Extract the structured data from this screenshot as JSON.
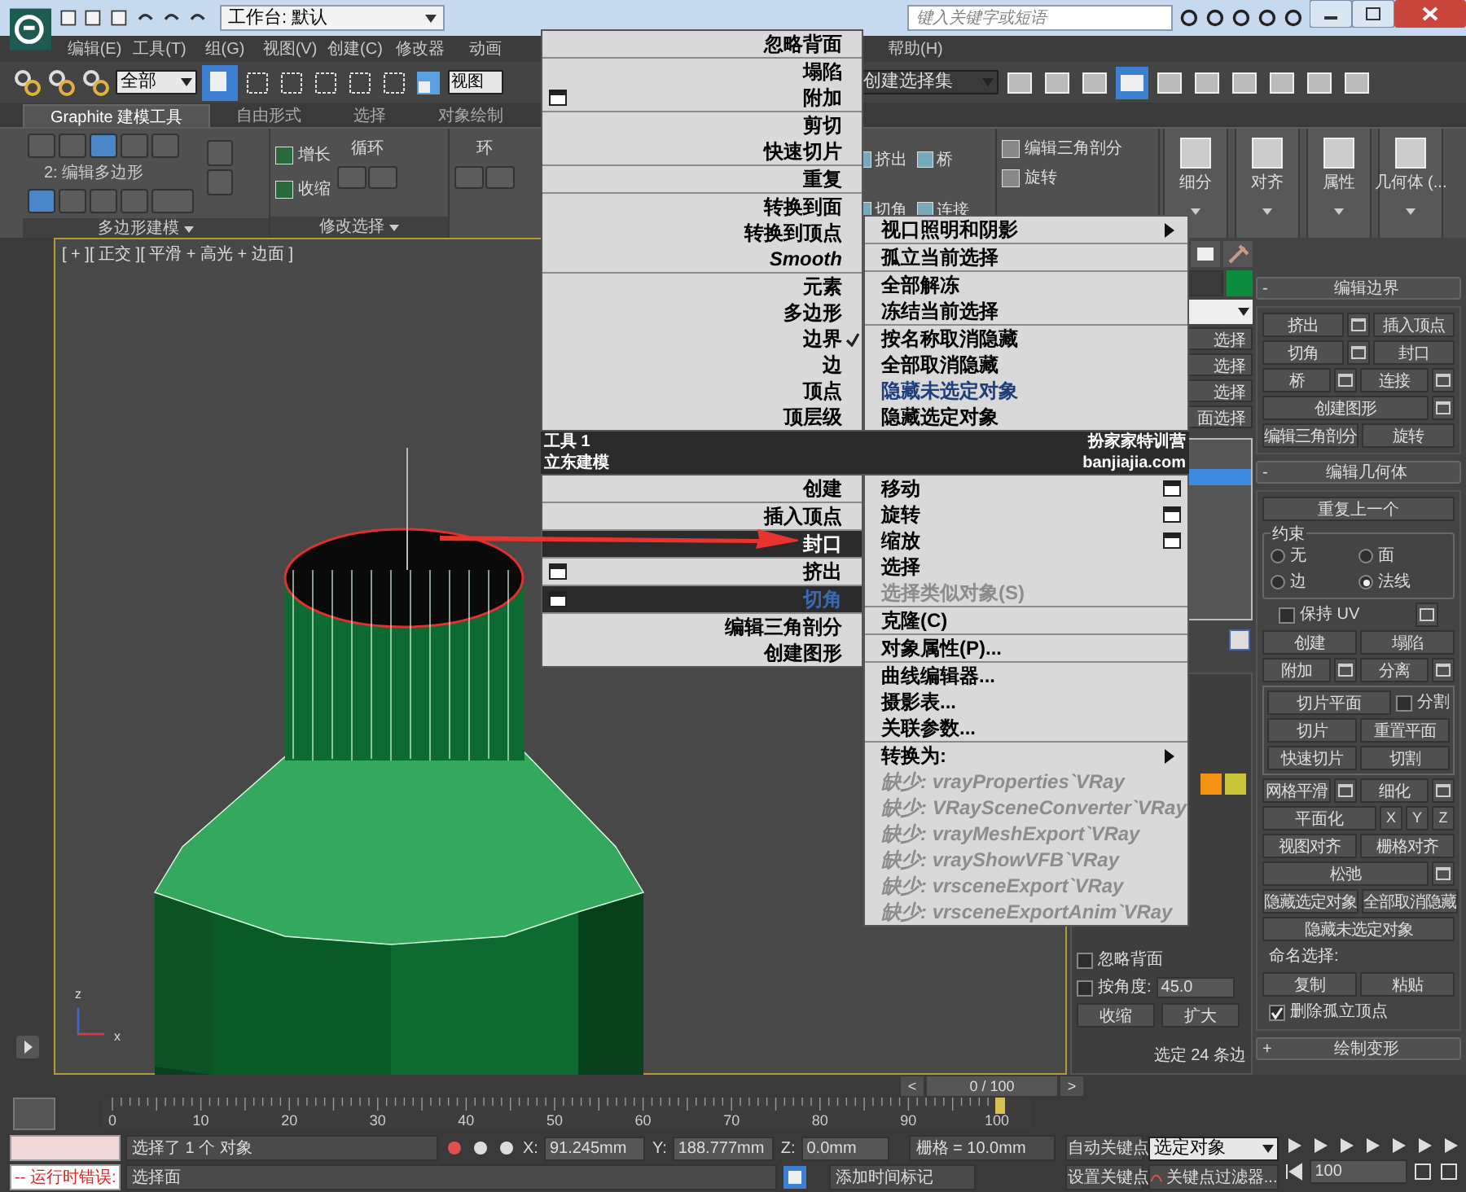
{
  "title_bar": {
    "workspace": "工作台: 默认",
    "search": {
      "placeholder": "键入关键字或短语"
    }
  },
  "menu_bar": [
    "编辑(E)",
    "工具(T)",
    "组(G)",
    "视图(V)",
    "创建(C)",
    "修改器",
    "动画",
    "帮助(H)"
  ],
  "toolbar": {
    "filter": "全部",
    "coord": "视图",
    "selection_set": "创建选择集"
  },
  "ribbon": {
    "tabs": [
      {
        "label": "Graphite 建模工具",
        "selected": true
      },
      {
        "label": "自由形式",
        "selected": false
      },
      {
        "label": "选择",
        "selected": false
      },
      {
        "label": "对象绘制",
        "selected": false
      }
    ],
    "level": "2: 编辑多边形",
    "grow": "增长",
    "shrink": "收缩",
    "loop": "循环",
    "ring": "环",
    "panels": [
      "多边形建模",
      "修改选择"
    ],
    "edit_tools": [
      "挤出",
      "桥",
      "切角",
      "连接"
    ],
    "tri": "编辑三角剖分",
    "turn": "旋转",
    "big_buttons": [
      "细分",
      "对齐",
      "属性",
      "几何体 (..."
    ]
  },
  "viewport": {
    "label": "[ + ][ 正交 ][ 平滑 + 高光 + 边面 ]",
    "axis_labels": [
      "z",
      "x"
    ]
  },
  "quad_menu": {
    "top_left": [
      [
        {
          "label": "忽略背面"
        }
      ],
      [
        {
          "label": "塌陷"
        },
        {
          "label": "附加",
          "options": true
        }
      ],
      [
        {
          "label": "剪切"
        },
        {
          "label": "快速切片"
        }
      ],
      [
        {
          "label": "重复"
        }
      ],
      [
        {
          "label": "转换到面"
        },
        {
          "label": "转换到顶点"
        },
        {
          "label": "Smooth",
          "italic": true
        }
      ],
      [
        {
          "label": "元素"
        },
        {
          "label": "多边形"
        },
        {
          "label": "边界",
          "checked": true
        },
        {
          "label": "边"
        },
        {
          "label": "顶点"
        },
        {
          "label": "顶层级"
        }
      ]
    ],
    "top_right": [
      [
        {
          "label": "视口照明和阴影",
          "submenu": true
        }
      ],
      [
        {
          "label": "孤立当前选择"
        }
      ],
      [
        {
          "label": "全部解冻"
        },
        {
          "label": "冻结当前选择"
        }
      ],
      [
        {
          "label": "按名称取消隐藏"
        },
        {
          "label": "全部取消隐藏"
        },
        {
          "label": "隐藏未选定对象",
          "accent": true
        },
        {
          "label": "隐藏选定对象"
        }
      ]
    ],
    "headers": [
      {
        "left": "工具 1",
        "right": "扮家家特训营"
      },
      {
        "left": "立东建模",
        "right": "banjiajia.com"
      }
    ],
    "bottom_left": [
      [
        {
          "label": "创建"
        }
      ],
      [
        {
          "label": "插入顶点"
        }
      ],
      [
        {
          "label": "封口",
          "selected": true
        }
      ],
      [
        {
          "label": "挤出",
          "options": true
        }
      ],
      [
        {
          "label": "切角",
          "options": true,
          "selected": true,
          "accent": true
        }
      ],
      [
        {
          "label": "编辑三角剖分"
        },
        {
          "label": "创建图形"
        }
      ]
    ],
    "bottom_right": [
      [
        {
          "label": "移动",
          "options": true
        },
        {
          "label": "旋转",
          "options": true
        },
        {
          "label": "缩放",
          "options": true
        },
        {
          "label": "选择"
        },
        {
          "label": "选择类似对象(S)",
          "disabled": true
        }
      ],
      [
        {
          "label": "克隆(C)"
        }
      ],
      [
        {
          "label": "对象属性(P)..."
        }
      ],
      [
        {
          "label": "曲线编辑器..."
        },
        {
          "label": "摄影表..."
        },
        {
          "label": "关联参数..."
        }
      ],
      [
        {
          "label": "转换为:",
          "submenu": true
        },
        {
          "label": "缺少: vrayProperties`VRay",
          "disabled": true,
          "italic": true
        },
        {
          "label": "缺少: VRaySceneConverter`VRay",
          "disabled": true,
          "italic": true
        },
        {
          "label": "缺少: vrayMeshExport`VRay",
          "disabled": true,
          "italic": true
        },
        {
          "label": "缺少: vrayShowVFB`VRay",
          "disabled": true,
          "italic": true
        },
        {
          "label": "缺少: vrsceneExport`VRay",
          "disabled": true,
          "italic": true
        },
        {
          "label": "缺少: vrsceneExportAnim`VRay",
          "disabled": true,
          "italic": true
        }
      ]
    ]
  },
  "command_panel": {
    "selection_buttons": [
      "选择",
      "选择",
      "选择",
      "面选择"
    ],
    "selection_rollout": {
      "ignore_backfacing": {
        "label": "忽略背面",
        "checked": false
      },
      "by_angle": {
        "label": "按角度:",
        "value": "45.0",
        "checked": false
      },
      "shrink": "收缩",
      "grow": "扩大",
      "status": "选定 24 条边"
    },
    "edit_borders": {
      "toggle": "-",
      "title": "编辑边界",
      "rows": [
        [
          {
            "label": "挤出",
            "options": true
          },
          {
            "label": "插入顶点"
          }
        ],
        [
          {
            "label": "切角",
            "options": true
          },
          {
            "label": "封口"
          }
        ],
        [
          {
            "label": "桥",
            "options": true
          },
          {
            "label": "连接",
            "options": true
          }
        ],
        [
          {
            "label": "创建图形",
            "options": true
          }
        ],
        [
          {
            "label": "编辑三角剖分"
          },
          {
            "label": "旋转"
          }
        ]
      ]
    },
    "edit_geometry": {
      "toggle": "-",
      "title": "编辑几何体",
      "repeat": "重复上一个",
      "constraints": {
        "title": "约束",
        "options": [
          {
            "label": "无",
            "selected": false
          },
          {
            "label": "边",
            "selected": false
          },
          {
            "label": "面",
            "selected": false
          },
          {
            "label": "法线",
            "selected": true
          }
        ]
      },
      "preserve_uv": {
        "label": "保持 UV",
        "checked": false
      },
      "rows1": [
        [
          {
            "label": "创建"
          },
          {
            "label": "塌陷"
          }
        ],
        [
          {
            "label": "附加",
            "options": true
          },
          {
            "label": "分离",
            "options": true
          }
        ]
      ],
      "slice_plane": "切片平面",
      "split": {
        "label": "分割",
        "checked": false
      },
      "rows2": [
        [
          {
            "label": "切片"
          },
          {
            "label": "重置平面"
          }
        ],
        [
          {
            "label": "快速切片"
          },
          {
            "label": "切割"
          }
        ]
      ],
      "rows3": [
        [
          {
            "label": "网格平滑",
            "options": true
          },
          {
            "label": "细化",
            "options": true
          }
        ]
      ],
      "planar": "平面化",
      "axes": [
        "X",
        "Y",
        "Z"
      ],
      "rows4": [
        [
          {
            "label": "视图对齐"
          },
          {
            "label": "栅格对齐"
          }
        ],
        [
          {
            "label": "松弛",
            "options": true
          }
        ],
        [
          {
            "label": "隐藏选定对象"
          },
          {
            "label": "全部取消隐藏"
          }
        ],
        [
          {
            "label": "隐藏未选定对象"
          }
        ]
      ],
      "named_sel": "命名选择:",
      "rows5": [
        [
          {
            "label": "复制"
          },
          {
            "label": "粘贴"
          }
        ]
      ],
      "delete_isolated": {
        "label": "删除孤立顶点",
        "checked": true
      }
    },
    "paint_deform": {
      "toggle": "+",
      "title": "绘制变形"
    }
  },
  "time_slider": {
    "position": "0 / 100",
    "prev": "<",
    "next": ">",
    "ticks": [
      "0",
      "10",
      "20",
      "30",
      "40",
      "50",
      "60",
      "70",
      "80",
      "90",
      "100"
    ]
  },
  "status_bar": {
    "runtime_error": "-- 运行时错误:",
    "selected": "选择了 1 个 对象",
    "prompt": "选择面",
    "x": {
      "label": "X:",
      "value": "91.245mm"
    },
    "y": {
      "label": "Y:",
      "value": "188.777mm"
    },
    "z": {
      "label": "Z:",
      "value": "0.0mm"
    },
    "grid": "栅格 = 10.0mm",
    "add_tag": "添加时间标记",
    "auto_key": "自动关键点",
    "set_key": "设置关键点",
    "key_mode": "选定对象",
    "key_filters": "关键点过滤器...",
    "frame": "100"
  }
}
